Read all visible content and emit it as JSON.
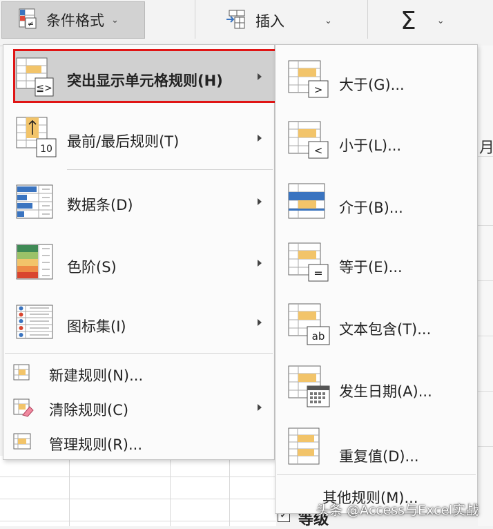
{
  "ribbon": {
    "conditional_format": "条件格式",
    "insert": "插入",
    "sum_symbol": "Σ",
    "caret": "⌄"
  },
  "menu": {
    "items": [
      {
        "label": "突出显示单元格规则(H)",
        "icon": "highlight-rules-icon",
        "submenu": true,
        "highlighted": true
      },
      {
        "label": "最前/最后规则(T)",
        "icon": "top-bottom-rules-icon",
        "submenu": true
      },
      {
        "label": "数据条(D)",
        "icon": "data-bars-icon",
        "submenu": true
      },
      {
        "label": "色阶(S)",
        "icon": "color-scales-icon",
        "submenu": true
      },
      {
        "label": "图标集(I)",
        "icon": "icon-sets-icon",
        "submenu": true
      },
      {
        "label": "新建规则(N)...",
        "icon": "new-rule-icon",
        "submenu": false
      },
      {
        "label": "清除规则(C)",
        "icon": "clear-rules-icon",
        "submenu": true
      },
      {
        "label": "管理规则(R)...",
        "icon": "manage-rules-icon",
        "submenu": false
      }
    ],
    "top10_text": "10"
  },
  "submenu": {
    "items": [
      {
        "label": "大于(G)...",
        "icon": "greater-than-icon",
        "symbol": ">"
      },
      {
        "label": "小于(L)...",
        "icon": "less-than-icon",
        "symbol": "<"
      },
      {
        "label": "介于(B)...",
        "icon": "between-icon",
        "symbol": ""
      },
      {
        "label": "等于(E)...",
        "icon": "equal-to-icon",
        "symbol": "="
      },
      {
        "label": "文本包含(T)...",
        "icon": "text-contains-icon",
        "symbol": "ab"
      },
      {
        "label": "发生日期(A)...",
        "icon": "date-occurring-icon",
        "symbol": ""
      },
      {
        "label": "重复值(D)...",
        "icon": "duplicate-values-icon",
        "symbol": ""
      }
    ],
    "more_rules": "其他规则(M)..."
  },
  "background": {
    "right_char": "月",
    "checkbox_mark": "✓",
    "level_label": "等级"
  },
  "watermark": "头条 @Access与Excel实战",
  "colors": {
    "highlight_border": "#e01515",
    "highlight_fill": "#d0d0d0",
    "cell_yellow": "#f2c46a",
    "bar_blue": "#3a74c0"
  }
}
